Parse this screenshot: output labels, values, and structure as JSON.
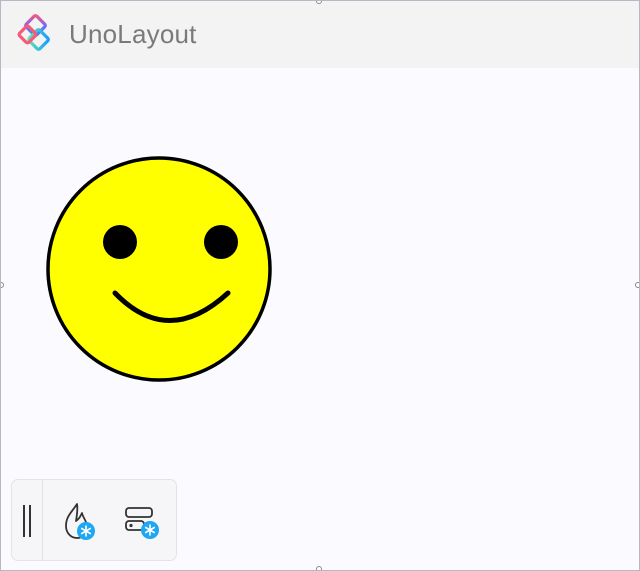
{
  "window": {
    "title": "UnoLayout",
    "app_icon": "uno-logo-icon"
  },
  "canvas": {
    "shape": "smiley-face",
    "colors": {
      "face_fill": "#ffff00",
      "outline": "#000000",
      "background": "#fbfafe"
    }
  },
  "toolbar": {
    "grip_icon": "drag-grip-icon",
    "buttons": [
      {
        "icon": "hot-reload-flame-icon",
        "badge_color": "#1ea7f3"
      },
      {
        "icon": "element-picker-icon",
        "badge_color": "#1ea7f3"
      }
    ]
  }
}
